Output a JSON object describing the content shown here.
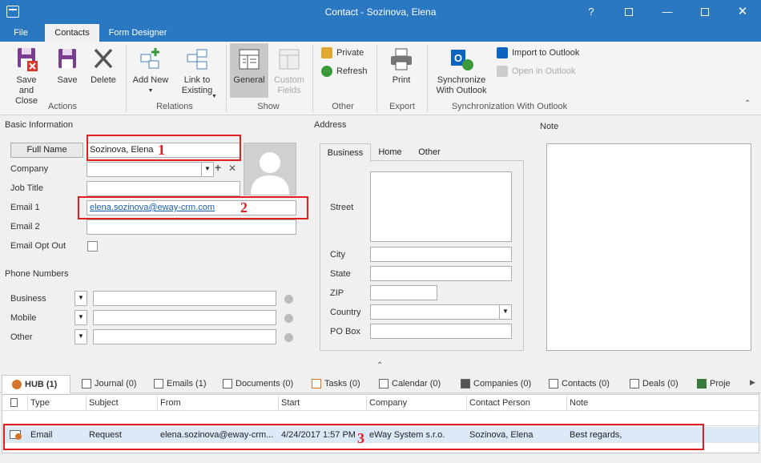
{
  "window": {
    "title": "Contact - Sozinova, Elena"
  },
  "menu": {
    "file": "File",
    "contacts": "Contacts",
    "form_designer": "Form Designer"
  },
  "ribbon": {
    "save_close": "Save and Close",
    "save": "Save",
    "delete": "Delete",
    "add_new": "Add New",
    "link_existing": "Link to Existing",
    "general": "General",
    "custom_fields": "Custom Fields",
    "private": "Private",
    "refresh": "Refresh",
    "print": "Print",
    "sync_outlook": "Synchronize With Outlook",
    "import_outlook": "Import to Outlook",
    "open_outlook": "Open in Outlook",
    "groups": {
      "actions": "Actions",
      "relations": "Relations",
      "show": "Show",
      "other": "Other",
      "export": "Export",
      "sync": "Synchronization With Outlook"
    }
  },
  "sections": {
    "basic_info": "Basic Information",
    "address": "Address",
    "note": "Note",
    "phone_numbers": "Phone Numbers"
  },
  "fields": {
    "full_name_btn": "Full Name",
    "full_name_value": "Sozinova, Elena",
    "company": "Company",
    "job_title": "Job Title",
    "email1": "Email 1",
    "email1_value": "elena.sozinova@eway-crm.com",
    "email2": "Email 2",
    "email_opt_out": "Email Opt Out",
    "phone_business": "Business",
    "phone_mobile": "Mobile",
    "phone_other": "Other"
  },
  "address": {
    "tabs": [
      "Business",
      "Home",
      "Other"
    ],
    "street": "Street",
    "city": "City",
    "state": "State",
    "zip": "ZIP",
    "country": "Country",
    "po_box": "PO Box"
  },
  "annotations": [
    "1",
    "2",
    "3"
  ],
  "hub_tabs": [
    "HUB (1)",
    "Journal (0)",
    "Emails (1)",
    "Documents (0)",
    "Tasks (0)",
    "Calendar (0)",
    "Companies (0)",
    "Contacts (0)",
    "Deals (0)",
    "Proje"
  ],
  "grid": {
    "columns": [
      "Type",
      "Subject",
      "From",
      "Start",
      "Company",
      "Contact Person",
      "Note"
    ],
    "rows": [
      {
        "type": "Email",
        "subject": "Request",
        "from": "elena.sozinova@eway-crm...",
        "start": "4/24/2017 1:57 PM",
        "company": "eWay System s.r.o.",
        "contact": "Sozinova, Elena",
        "note": "Best regards,"
      }
    ]
  },
  "colors": {
    "accent": "#2b78c2",
    "annotation": "#e02020",
    "link": "#1a5fb4"
  }
}
